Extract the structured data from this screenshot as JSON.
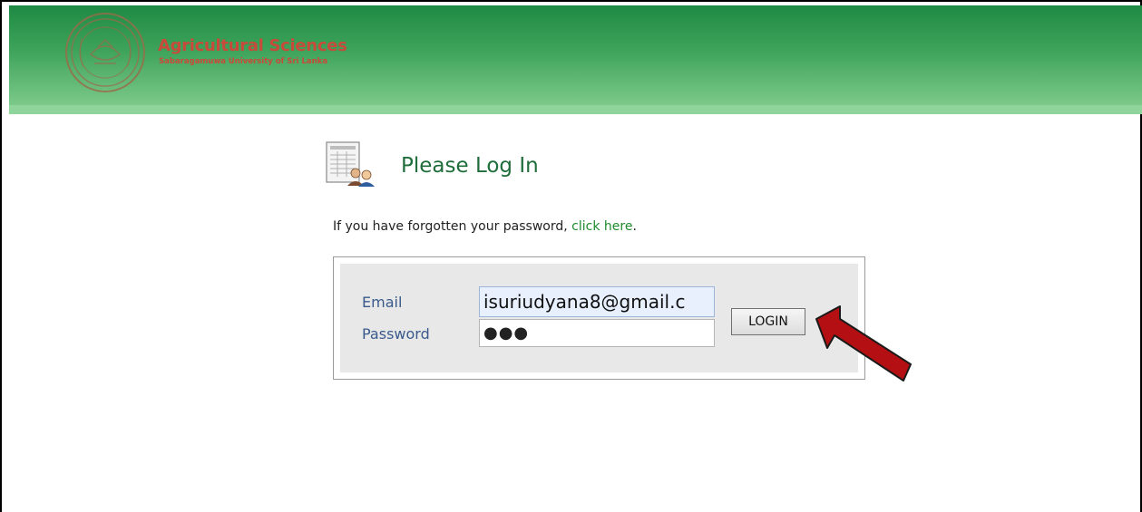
{
  "header": {
    "logo_title": "Agricultural Sciences",
    "logo_subtitle": "Sabaragamuwa University of Sri Lanka",
    "header_color_top": "#1e8a44",
    "header_color_bottom": "#7cc98a",
    "logo_text_color": "#c84a3a"
  },
  "page": {
    "title": "Please Log In",
    "title_icon": "user-document-icon",
    "forgot_prefix": "If you have forgotten your password, ",
    "forgot_link": "click here",
    "forgot_suffix": "."
  },
  "login_form": {
    "email_label": "Email",
    "email_value": "isuriudyana8@gmail.c",
    "password_label": "Password",
    "password_value": "●●●",
    "login_button": "LOGIN"
  },
  "annotation": {
    "arrow_color": "#b40f12",
    "arrow_icon": "red-arrow-icon"
  }
}
